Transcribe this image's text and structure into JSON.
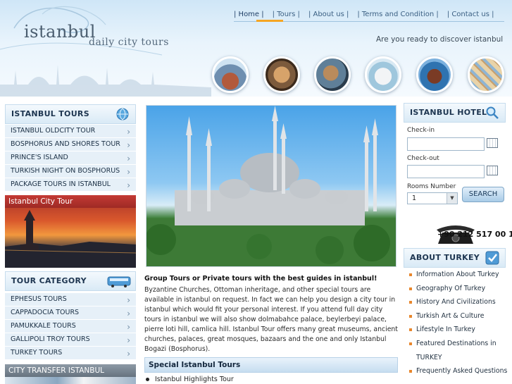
{
  "header": {
    "logo_main": "istanbul",
    "logo_sub": "daily city tours",
    "tagline": "Are you ready to discover istanbul",
    "nav": [
      "| Home |",
      "| Tours |",
      "| About us |",
      "| Terms and Condition |",
      "| Contact us |"
    ]
  },
  "left": {
    "tours_title": "ISTANBUL TOURS",
    "tours": [
      "ISTANBUL OLDCITY TOUR",
      "BOSPHORUS AND SHORES TOUR",
      "PRINCE'S ISLAND",
      "TURKISH NIGHT ON BOSPHORUS",
      "PACKAGE TOURS IN ISTANBUL"
    ],
    "city_tour_label": "Istanbul City Tour",
    "category_title": "TOUR CATEGORY",
    "categories": [
      "EPHESUS TOURS",
      "CAPPADOCIA TOURS",
      "PAMUKKALE TOURS",
      "GALLIPOLI TROY TOURS",
      "TURKEY TOURS"
    ],
    "transfer_label": "CITY TRANSFER ISTANBUL"
  },
  "center": {
    "intro_title": "Group Tours or Private tours with the best guides in istanbul!",
    "intro_body": "Byzantine Churches, Ottoman inheritage, and other special tours are available in istanbul on request. In fact we can help you design a city tour in istanbul which would fit your personal interest. If you attend full day city tours in istanbul we will also show dolmabahce palace, beylerbeyi palace, pierre loti hill, camlica hill. Istanbul Tour offers many great museums, ancient churches, palaces, great mosques, bazaars and the one and only Istanbul Bogazi (Bosphorus).",
    "special_title": "Special Istanbul Tours",
    "special_items": [
      "Istanbul Highlights Tour"
    ]
  },
  "right": {
    "hotels_title": "ISTANBUL HOTELS",
    "checkin_label": "Check-in",
    "checkout_label": "Check-out",
    "rooms_label": "Rooms Number",
    "rooms_value": "1",
    "search_label": "SEARCH",
    "phone": "+90 212 517 00 13",
    "about_title": "ABOUT TURKEY",
    "about_items": [
      "Information About Turkey",
      "Geography Of Turkey",
      "History And Civilizations",
      "Turkish Art & Culture",
      "Lifestyle In Turkey",
      "Featured Destinations in",
      "TURKEY",
      "Frequently Asked Questions"
    ]
  },
  "colors": {
    "accent": "#f5a623",
    "header_bg": "#cfe6f7",
    "list_bg": "#e6f0f8",
    "city_tour_red": "#c43a34",
    "bullet": "#e8872d"
  }
}
